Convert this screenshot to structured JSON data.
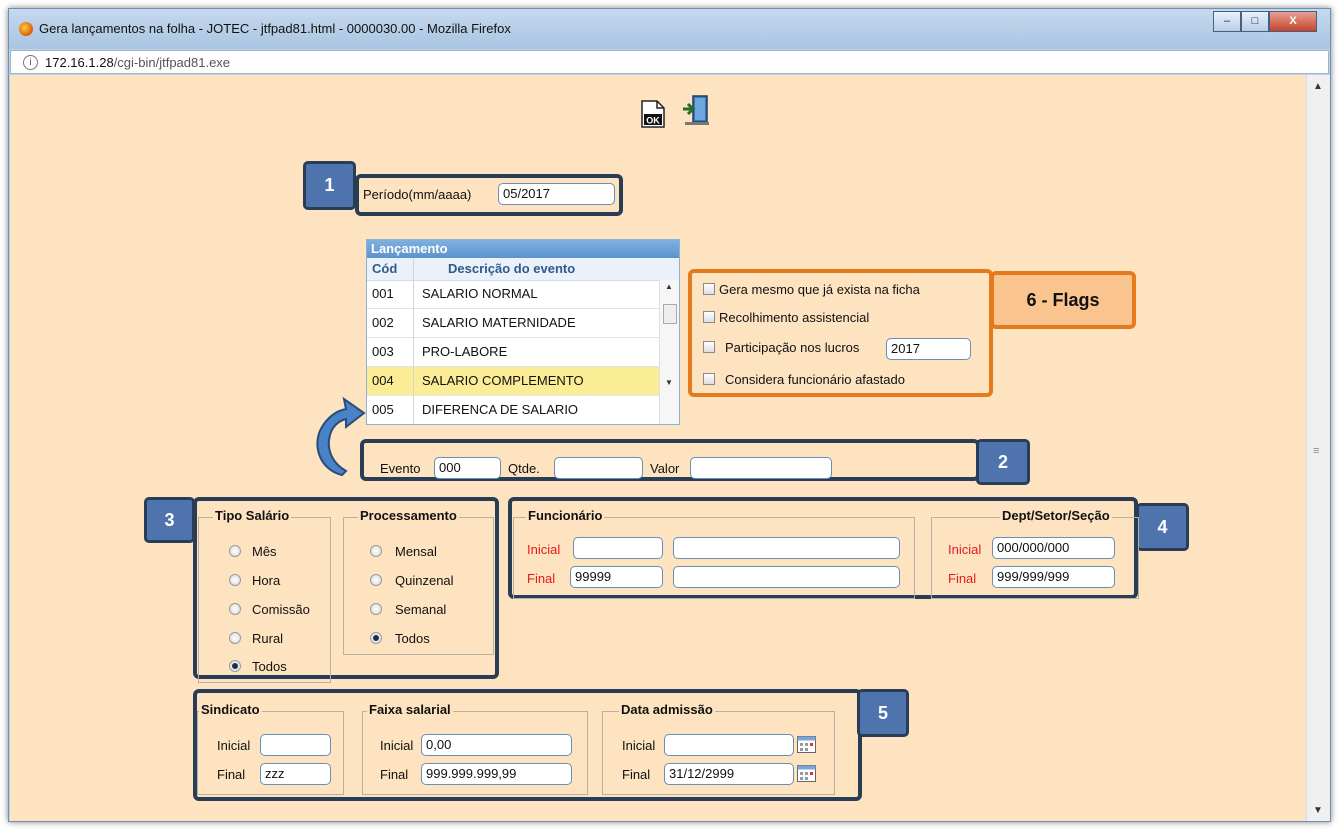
{
  "window": {
    "title": "Gera lançamentos na folha - JOTEC - jtfpad81.html - 0000030.00 - Mozilla Firefox",
    "controls": {
      "minimize": "–",
      "maximize": "□",
      "close": "X"
    }
  },
  "address": {
    "host": "172.16.1.28",
    "path": "/cgi-bin/jtfpad81.exe"
  },
  "toolbar": {
    "ok_icon": "ok-document-icon",
    "exit_icon": "exit-door-icon"
  },
  "periodo": {
    "label": "Período(mm/aaaa)",
    "value": "05/2017",
    "badge": "1"
  },
  "lancamento": {
    "title": "Lançamento",
    "col_code": "Cód",
    "col_desc": "Descrição do evento",
    "rows": [
      {
        "code": "001",
        "desc": "SALARIO NORMAL"
      },
      {
        "code": "002",
        "desc": "SALARIO MATERNIDADE"
      },
      {
        "code": "003",
        "desc": "PRO-LABORE"
      },
      {
        "code": "004",
        "desc": "SALARIO COMPLEMENTO"
      },
      {
        "code": "005",
        "desc": "DIFERENCA DE SALARIO"
      }
    ],
    "selected_code": "004"
  },
  "flags": {
    "badge": "6 - Flags",
    "gera_mesmo": "Gera mesmo que já exista na ficha",
    "recolhimento": "Recolhimento assistencial",
    "participacao": "Participação nos lucros",
    "participacao_ano": "2017",
    "considera_afastado": "Considera funcionário afastado"
  },
  "evento": {
    "badge": "2",
    "evento_label": "Evento",
    "evento_value": "000",
    "qtde_label": "Qtde.",
    "qtde_value": "",
    "valor_label": "Valor",
    "valor_value": ""
  },
  "tipo_salario": {
    "badge": "3",
    "legend": "Tipo Salário",
    "options": [
      "Mês",
      "Hora",
      "Comissão",
      "Rural",
      "Todos"
    ],
    "selected": "Todos"
  },
  "processamento": {
    "legend": "Processamento",
    "options": [
      "Mensal",
      "Quinzenal",
      "Semanal",
      "Todos"
    ],
    "selected": "Todos"
  },
  "funcionario": {
    "badge": "4",
    "legend": "Funcionário",
    "inicial_label": "Inicial",
    "inicial_code": "",
    "inicial_name": "",
    "final_label": "Final",
    "final_code": "99999",
    "final_name": ""
  },
  "dept": {
    "legend": "Dept/Setor/Seção",
    "inicial_label": "Inicial",
    "inicial_value": "000/000/000",
    "final_label": "Final",
    "final_value": "999/999/999"
  },
  "sindicato": {
    "badge": "5",
    "legend": "Sindicato",
    "inicial_label": "Inicial",
    "inicial_value": "",
    "final_label": "Final",
    "final_value": "zzz"
  },
  "faixa": {
    "legend": "Faixa salarial",
    "inicial_label": "Inicial",
    "inicial_value": "0,00",
    "final_label": "Final",
    "final_value": "999.999.999,99"
  },
  "admissao": {
    "legend": "Data admissão",
    "inicial_label": "Inicial",
    "inicial_value": "",
    "final_label": "Final",
    "final_value": "31/12/2999",
    "calendar_icon": "calendar-icon"
  },
  "colors": {
    "page_bg": "#fde3c0",
    "callout_navy": "#2a3d57",
    "callout_orange": "#e57a1d",
    "badge_blue": "#4f74ad",
    "flag_badge": "#f9c48e",
    "required_red": "#e21c1c"
  }
}
